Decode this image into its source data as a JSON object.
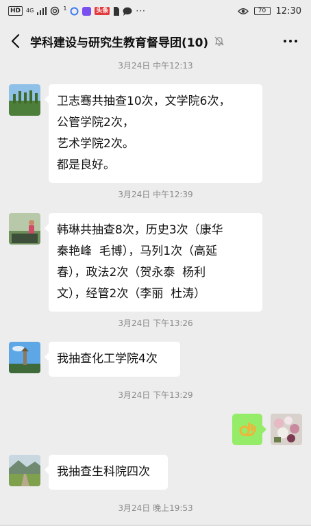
{
  "status_bar": {
    "left_badges": [
      "HD",
      "4G"
    ],
    "battery": "70",
    "time": "12:30",
    "icons": [
      "signal-icon",
      "hotspot-icon",
      "notification-dot",
      "app-icon-blue",
      "app-icon-purple",
      "app-icon-red",
      "sim-icon",
      "message-icon",
      "more-notifications-icon",
      "eye-icon",
      "battery-icon"
    ]
  },
  "header": {
    "title": "学科建设与研究生教育督导团(10)",
    "back_icon": "chevron-left-icon",
    "mute_icon": "bell-off-icon",
    "more_icon": "more-dots-icon"
  },
  "colors": {
    "background": "#ededed",
    "bubble_incoming": "#ffffff",
    "bubble_outgoing": "#95ec69",
    "timestamp": "#8a8a8a"
  },
  "messages": [
    {
      "type": "timestamp",
      "text": "3月24日 中午12:13"
    },
    {
      "type": "incoming",
      "avatar": "landscape-trees-avatar",
      "lines": [
        "卫志骞共抽查10次，文学院6次，",
        "公管学院2次，",
        "艺术学院2次。",
        "都是良好。"
      ]
    },
    {
      "type": "timestamp",
      "text": "3月24日 中午12:39"
    },
    {
      "type": "incoming",
      "avatar": "person-garden-avatar",
      "lines": [
        "韩琳共抽查8次，历史3次（康华",
        "秦艳峰  毛博），马列1次（高延",
        "春），政法2次（贺永泰  杨利",
        "文），经管2次（李丽  杜涛）"
      ]
    },
    {
      "type": "timestamp",
      "text": "3月24日 下午13:26"
    },
    {
      "type": "incoming",
      "avatar": "pagoda-sky-avatar",
      "lines": [
        "我抽查化工学院4次"
      ]
    },
    {
      "type": "timestamp",
      "text": "3月24日 下午13:29"
    },
    {
      "type": "outgoing",
      "avatar": "flowers-avatar",
      "content": "ok-hand-emoji"
    },
    {
      "type": "incoming",
      "avatar": "mountain-road-avatar",
      "lines": [
        "我抽查生科院四次"
      ]
    },
    {
      "type": "timestamp",
      "text": "3月24日 晚上19:53"
    }
  ]
}
